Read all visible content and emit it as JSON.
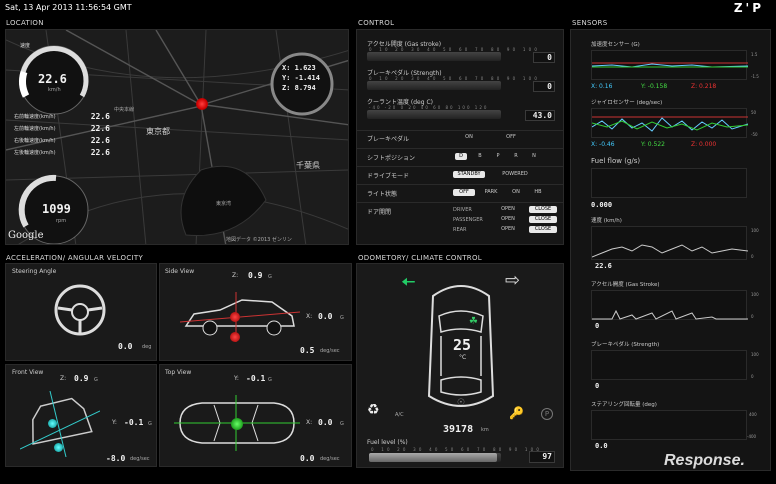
{
  "datetime": "Sat, 13 Apr 2013 11:56:54 GMT",
  "brand": "Z'P",
  "location": {
    "title": "LOCATION",
    "speed_label": "速度",
    "speed_value": "22.6",
    "speed_unit": "km/h",
    "wheels": [
      {
        "label": "右前輪速度(km/h)",
        "value": "22.6"
      },
      {
        "label": "左前輪速度(km/h)",
        "value": "22.6"
      },
      {
        "label": "右後輪速度(km/h)",
        "value": "22.6"
      },
      {
        "label": "左後輪速度(km/h)",
        "value": "22.6"
      }
    ],
    "rpm_value": "1099",
    "rpm_unit": "rpm",
    "coords": {
      "x": "1.623",
      "y": "-1.414",
      "z": "8.794"
    },
    "map_labels": [
      "東京都",
      "千葉県",
      "中央本線",
      "大宮",
      "東京湾"
    ],
    "google": "Google",
    "map_credit": "地図データ ©2013 ゼンリン"
  },
  "control": {
    "title": "CONTROL",
    "ticks": "0 10 20 30 40 50 60 70 80 90 100",
    "gas_label": "アクセル開度 (Gas stroke)",
    "gas_value": "0",
    "brake_label": "ブレーキペダル (Strength)",
    "brake_value": "0",
    "coolant_label": "クーラント温度 (deg C)",
    "coolant_ticks": "-40 -20 0 20 40 60 80 100 120",
    "coolant_value": "43.0",
    "rows": [
      {
        "label": "ブレーキペダル",
        "opts": [
          "ON",
          "OFF"
        ],
        "active": -1
      },
      {
        "label": "シフトポジション",
        "opts": [
          "D",
          "B",
          "P",
          "R",
          "N"
        ],
        "active": 0
      },
      {
        "label": "ドライブモード",
        "opts": [
          "STANDBY",
          "POWERED"
        ],
        "active": 0
      },
      {
        "label": "ライト状態",
        "opts": [
          "OFF",
          "PARK",
          "ON",
          "HB"
        ],
        "active": 0
      }
    ],
    "door_label": "ドア開閉",
    "doors": [
      {
        "name": "DRIVER",
        "open": "OPEN",
        "close": "CLOSE"
      },
      {
        "name": "PASSENGER",
        "open": "OPEN",
        "close": "CLOSE"
      },
      {
        "name": "REAR",
        "open": "OPEN",
        "close": "CLOSE"
      }
    ]
  },
  "sensors": {
    "title": "SENSORS",
    "accel": {
      "label": "加速度センサー (G)",
      "x": "X: 0.16",
      "y": "Y: -0.158",
      "z": "Z: 0.218",
      "top": "1.5",
      "bottom": "-1.5"
    },
    "gyro": {
      "label": "ジャイロセンサー (deg/sec)",
      "x": "X: -0.46",
      "y": "Y: 0.522",
      "z": "Z: 0.000",
      "top": "50",
      "bottom": "-50"
    },
    "fuel": {
      "label": "Fuel flow (g/s)",
      "value": "0.000"
    },
    "speed": {
      "label": "速度 (km/h)",
      "value": "22.6",
      "top": "100",
      "bottom": "0"
    },
    "gas": {
      "label": "アクセル開度 (Gas Stroke)",
      "value": "0",
      "top": "100",
      "bottom": "0"
    },
    "brake": {
      "label": "ブレーキペダル (Strength)",
      "value": "0",
      "top": "100",
      "bottom": "0"
    },
    "steer": {
      "label": "ステアリング回転量 (deg)",
      "value": "0.0",
      "top": "400",
      "bottom": "-400"
    }
  },
  "accel_panel": {
    "title": "ACCELERATION/ ANGULAR VELOCITY",
    "steering": {
      "title": "Steering Angle",
      "value": "0.0",
      "unit": "deg"
    },
    "side": {
      "title": "Side View",
      "z": "Z:",
      "z_value": "0.9",
      "x": "X:",
      "x_value": "0.0",
      "g": "G",
      "rate": "0.5",
      "rate_unit": "deg/sec"
    },
    "front": {
      "title": "Front View",
      "z": "Z:",
      "z_value": "0.9",
      "y": "Y:",
      "y_value": "-0.1",
      "g": "G",
      "rate": "-8.0",
      "rate_unit": "deg/sec"
    },
    "top": {
      "title": "Top View",
      "y": "Y:",
      "y_value": "-0.1",
      "x": "X:",
      "x_value": "0.0",
      "g": "G",
      "rate": "0.0",
      "rate_unit": "deg/sec"
    }
  },
  "odometry": {
    "title": "ODOMETORY/ CLIMATE CONTROL",
    "temp": "25",
    "temp_unit": "°C",
    "ac": "A/C",
    "odo": "39178",
    "odo_unit": "km",
    "fuel_label": "Fuel level (%)",
    "fuel_ticks": "0 10 20 30 40 50 60 70 80 90 100",
    "fuel_value": "97",
    "fuel_level": 97
  },
  "watermark": "Response."
}
